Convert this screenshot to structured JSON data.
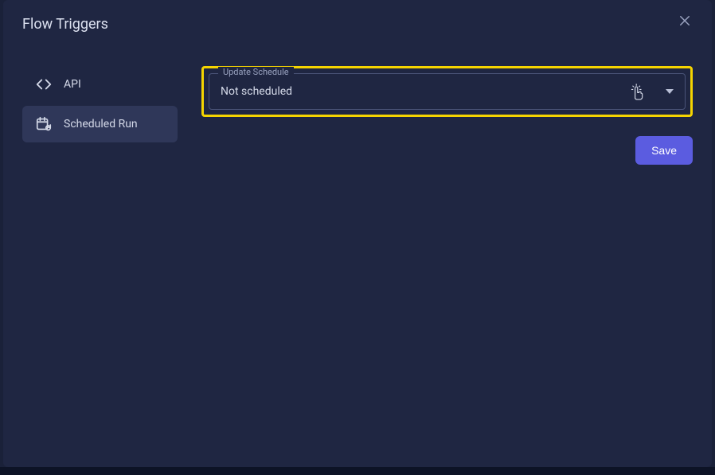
{
  "header": {
    "title": "Flow Triggers"
  },
  "sidebar": {
    "items": [
      {
        "label": "API",
        "icon": "code"
      },
      {
        "label": "Scheduled Run",
        "icon": "calendar"
      }
    ],
    "activeIndex": 1
  },
  "schedule": {
    "label": "Update Schedule",
    "value": "Not scheduled"
  },
  "actions": {
    "save_label": "Save"
  }
}
